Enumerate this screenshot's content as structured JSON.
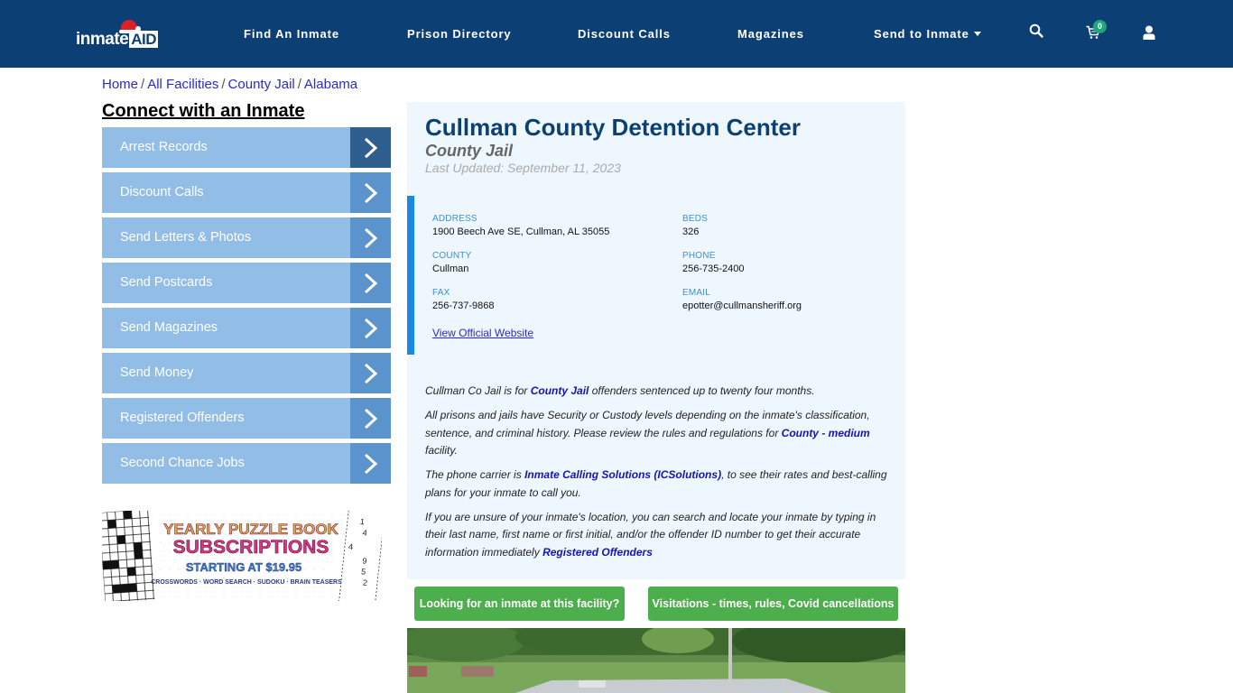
{
  "navbar": {
    "logo_text": "inmate",
    "logo_text_boxed": "AID",
    "links": [
      {
        "label": "Find An Inmate"
      },
      {
        "label": "Prison Directory"
      },
      {
        "label": "Discount Calls"
      },
      {
        "label": "Magazines"
      },
      {
        "label": "Send to Inmate",
        "has_dropdown": true
      }
    ],
    "icons": [
      "search-icon",
      "cart-icon",
      "user-icon"
    ],
    "cart_count": "0"
  },
  "breadcrumb": [
    {
      "label": "Home"
    },
    {
      "label": "All Facilities"
    },
    {
      "label": "County Jail"
    },
    {
      "label": "Alabama"
    }
  ],
  "breadcrumb_separator": "/",
  "sidebar": {
    "title": "Connect with an Inmate",
    "items": [
      {
        "label": "Arrest Records"
      },
      {
        "label": "Discount Calls"
      },
      {
        "label": "Send Letters & Photos"
      },
      {
        "label": "Send Postcards"
      },
      {
        "label": "Send Magazines"
      },
      {
        "label": "Send Money"
      },
      {
        "label": "Registered Offenders"
      },
      {
        "label": "Second Chance Jobs"
      }
    ],
    "ad": {
      "line1": "YEARLY PUZZLE BOOK",
      "line2": "SUBSCRIPTIONS",
      "line3": "STARTING AT $19.95",
      "line4": "CROSSWORDS · WORD SEARCH · SUDOKU · BRAIN TEASERS"
    }
  },
  "facility": {
    "name": "Cullman County Detention Center",
    "type": "County Jail",
    "last_updated": "Last Updated: September 11, 2023",
    "fields": {
      "address": {
        "label": "ADDRESS",
        "value": "1900 Beech Ave SE, Cullman, AL 35055"
      },
      "beds": {
        "label": "BEDS",
        "value": "326"
      },
      "county": {
        "label": "COUNTY",
        "value": "Cullman"
      },
      "phone": {
        "label": "PHONE",
        "value": "256-735-2400"
      },
      "fax": {
        "label": "FAX",
        "value": "256-737-9868"
      },
      "email": {
        "label": "EMAIL",
        "value": "epotter@cullmansheriff.org"
      }
    },
    "website_link": "View Official Website",
    "description": {
      "p1": {
        "pre": "Cullman Co Jail is for ",
        "link": "County Jail",
        "post": " offenders sentenced up to twenty four months."
      },
      "p2": {
        "pre": "All prisons and jails have Security or Custody levels depending on the inmate's classification, sentence, and criminal history. Please review the rules and regulations for ",
        "link": "County - medium",
        "post": " facility."
      },
      "p3": {
        "pre": "The phone carrier is ",
        "link": "Inmate Calling Solutions (ICSolutions)",
        "post": ", to see their rates and best-calling plans for your inmate to call you."
      },
      "p4": {
        "pre": "If you are unsure of your inmate's location, you can search and locate your inmate by typing in their last name, first name or first initial, and/or the offender ID number to get their accurate information immediately ",
        "link": "Registered Offenders",
        "post": ""
      }
    }
  },
  "buttons": {
    "find_inmate": "Looking for an inmate at this facility?",
    "visitation": "Visitations - times, rules, Covid cancellations"
  },
  "colors": {
    "navbar": "#0c3f73",
    "sidebar_item": "#92bde6",
    "sidebar_arrow": "#5b93cc",
    "sidebar_arrow_active": "#2f5f8f",
    "card_bg": "#eef7fd",
    "info_accent": "#1b87e6",
    "green_button": "#4cae4c",
    "link": "#1414b8"
  }
}
